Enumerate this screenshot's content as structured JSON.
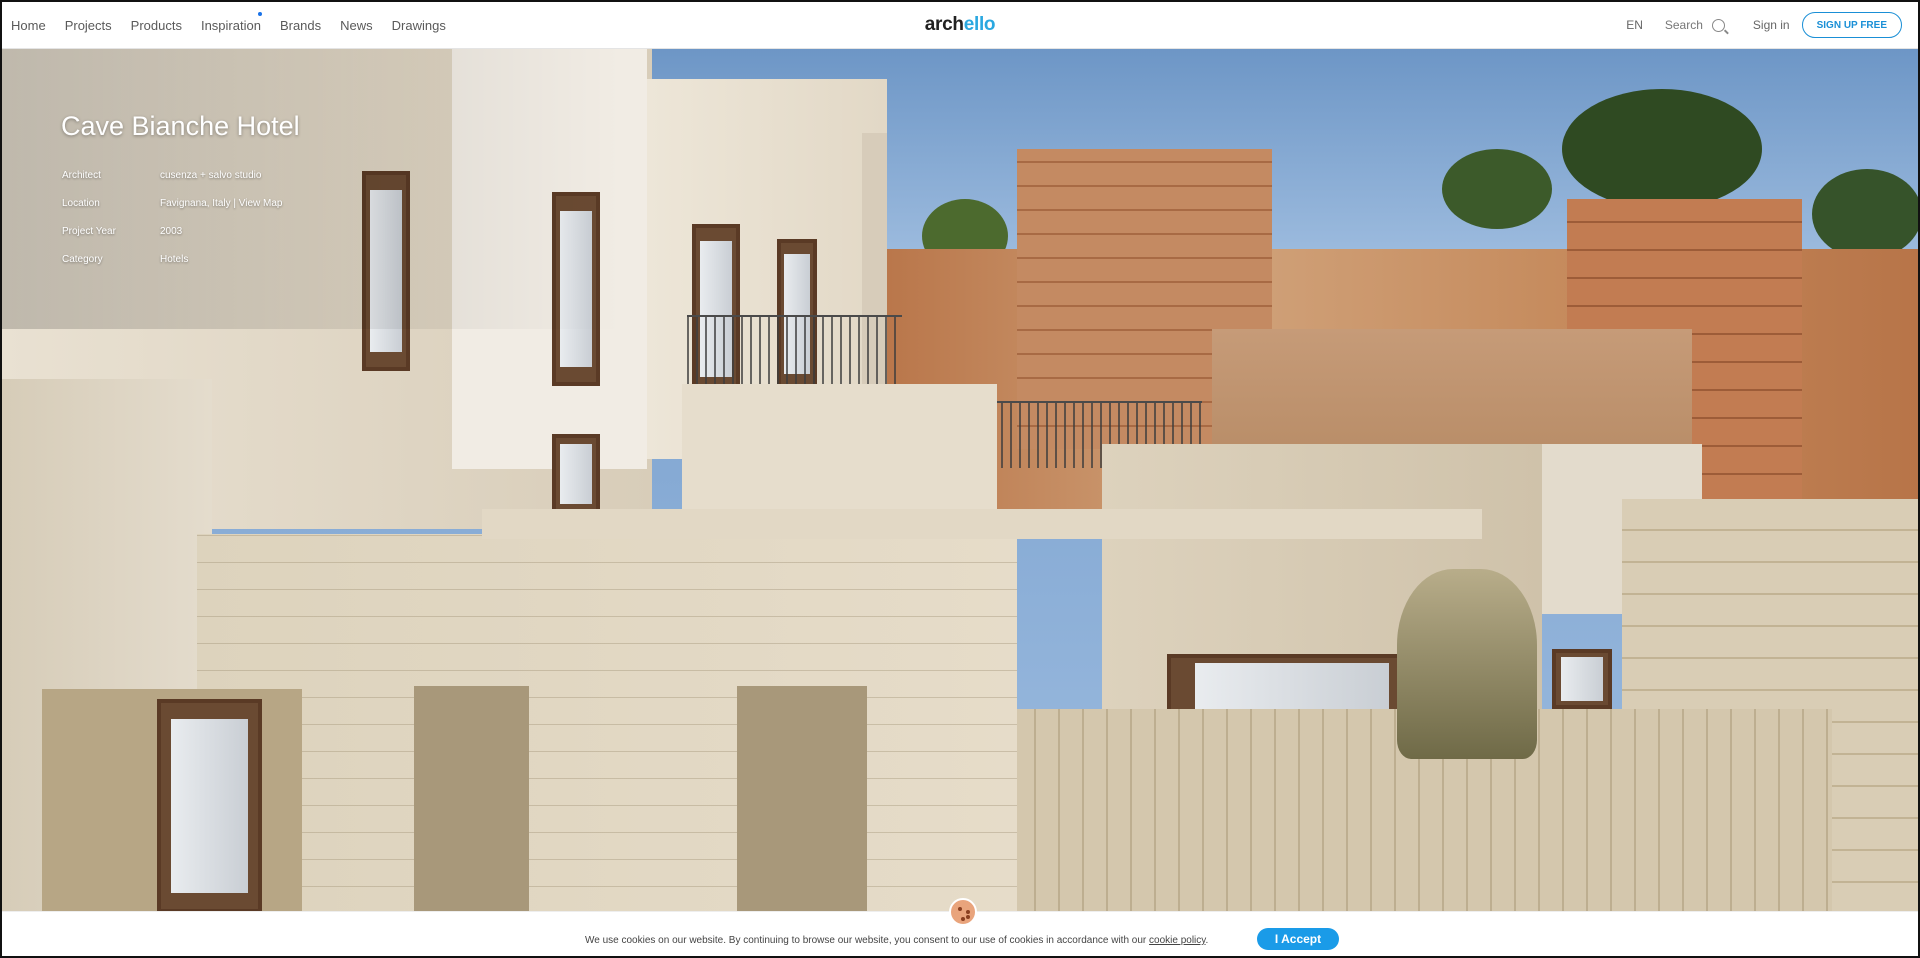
{
  "nav": {
    "links": [
      "Home",
      "Projects",
      "Products",
      "Inspiration",
      "Brands",
      "News",
      "Drawings"
    ],
    "logo_part1": "arch",
    "logo_part2": "ello",
    "language": "EN",
    "search_label": "Search",
    "signin_label": "Sign in",
    "signup_label": "SIGN UP FREE"
  },
  "project": {
    "title": "Cave Bianche Hotel",
    "details": [
      {
        "label": "Architect",
        "value": "cusenza + salvo studio"
      },
      {
        "label": "Location",
        "value": "Favignana, Italy",
        "link": "View Map"
      },
      {
        "label": "Project Year",
        "value": "2003"
      },
      {
        "label": "Category",
        "value": "Hotels"
      }
    ]
  },
  "cookie": {
    "text": "We use cookies on our website. By continuing to browse our website, you consent to our use of cookies in accordance with our",
    "link": "cookie policy",
    "suffix": ".",
    "accept_label": "I Accept"
  },
  "colors": {
    "accent": "#1a9be8",
    "logo_accent": "#2aa8e0"
  }
}
